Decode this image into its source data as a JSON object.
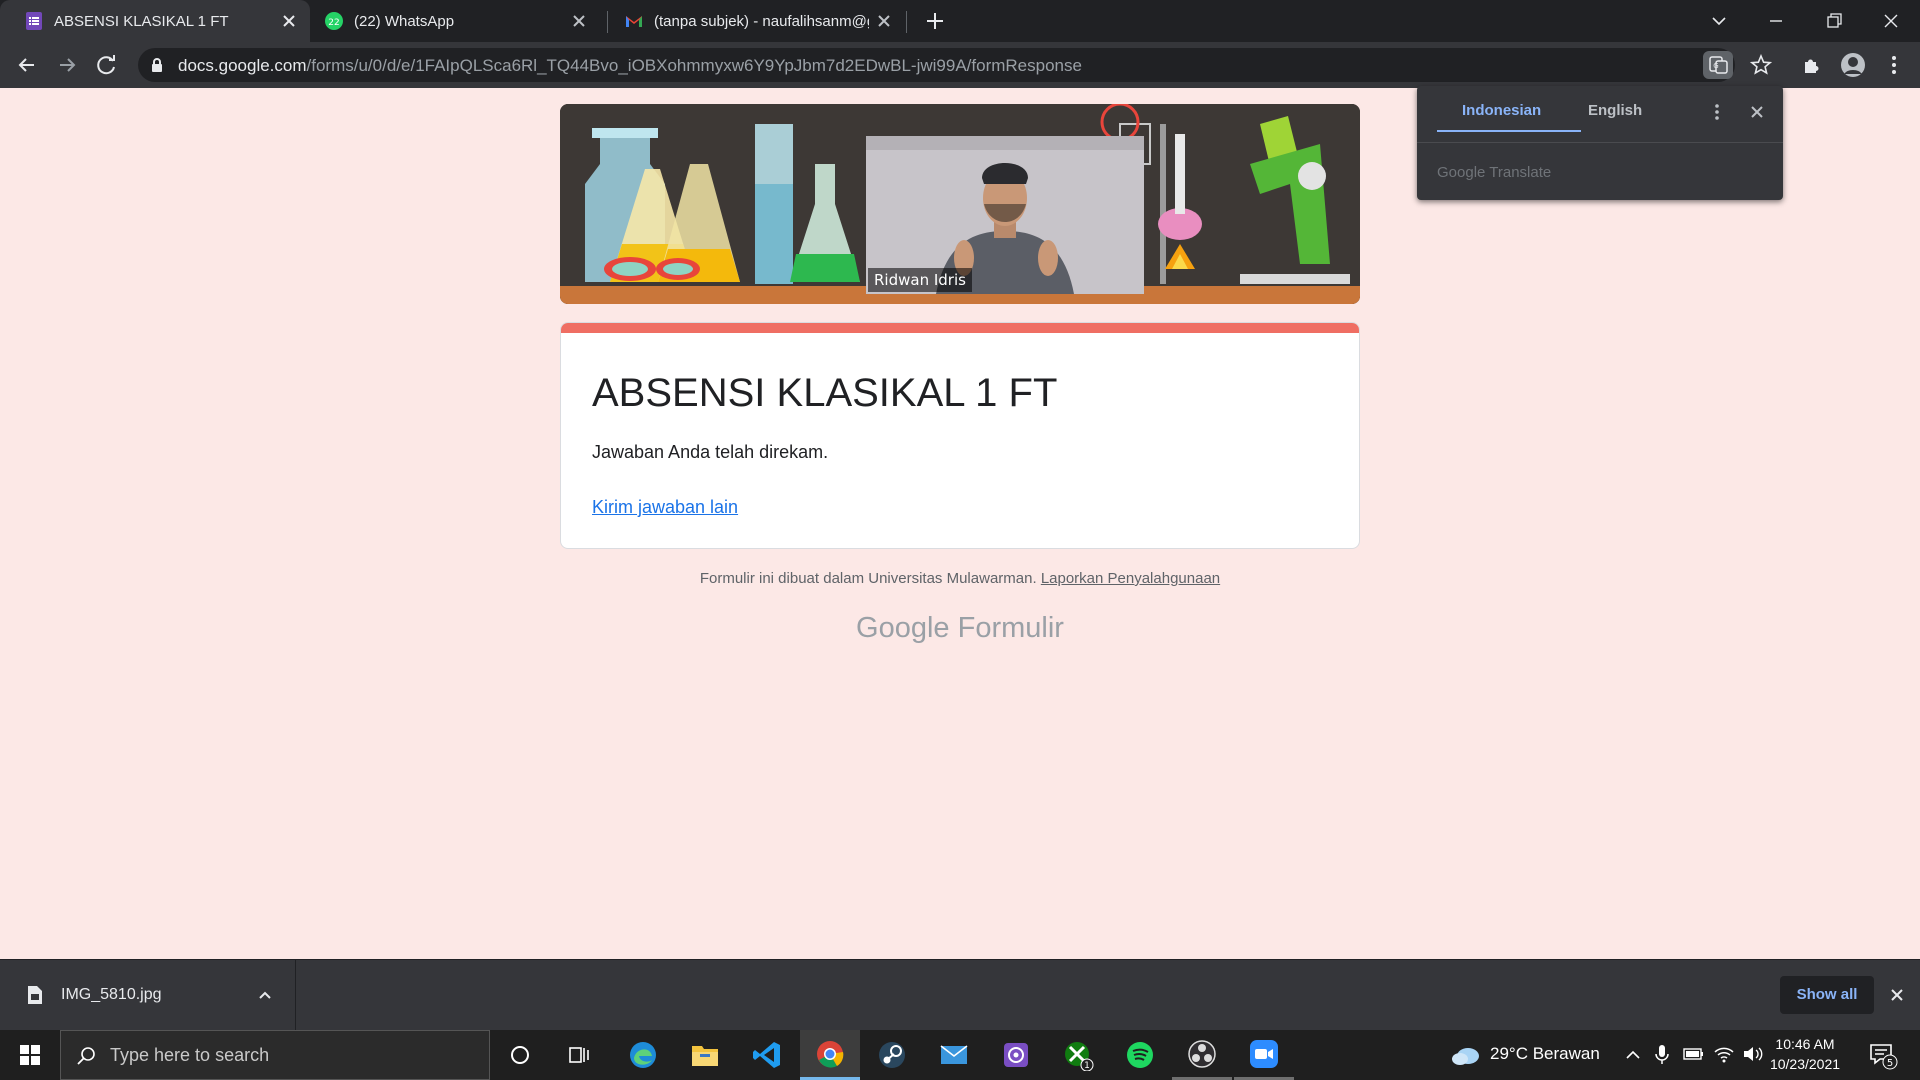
{
  "browser": {
    "tabs": [
      {
        "label": "ABSENSI KLASIKAL 1 FT",
        "icon": "google-forms-icon",
        "active": true
      },
      {
        "label": "(22) WhatsApp",
        "icon": "whatsapp-icon",
        "badge": "22",
        "active": false
      },
      {
        "label": "(tanpa subjek) - naufalihsanm@g",
        "icon": "gmail-icon",
        "active": false
      }
    ],
    "url_host": "docs.google.com",
    "url_path": "/forms/u/0/d/e/1FAIpQLSca6Rl_TQ44Bvo_iOBXohmmyxw6Y9YpJbm7d2EDwBL-jwi99A/formResponse"
  },
  "translate_popup": {
    "tab_source": "Indonesian",
    "tab_target": "English",
    "brand": "Google Translate"
  },
  "video_overlay": {
    "participant_name": "Ridwan Idris"
  },
  "form": {
    "title": "ABSENSI KLASIKAL 1 FT",
    "confirmation": "Jawaban Anda telah direkam.",
    "another_response_link": "Kirim jawaban lain",
    "footer_text": "Formulir ini dibuat dalam Universitas Mulawarman.",
    "report_link": "Laporkan Penyalahgunaan",
    "logo_google": "Google",
    "logo_product": "Formulir"
  },
  "downloads": {
    "filename": "IMG_5810.jpg",
    "show_all": "Show all"
  },
  "taskbar": {
    "search_placeholder": "Type here to search",
    "weather": "29°C  Berawan",
    "time": "10:46 AM",
    "date": "10/23/2021",
    "notification_count": "5",
    "xbox_badge": "1"
  },
  "colors": {
    "page_background": "#fce8e6",
    "form_accent": "#ef6e63",
    "link": "#1a73e8"
  }
}
